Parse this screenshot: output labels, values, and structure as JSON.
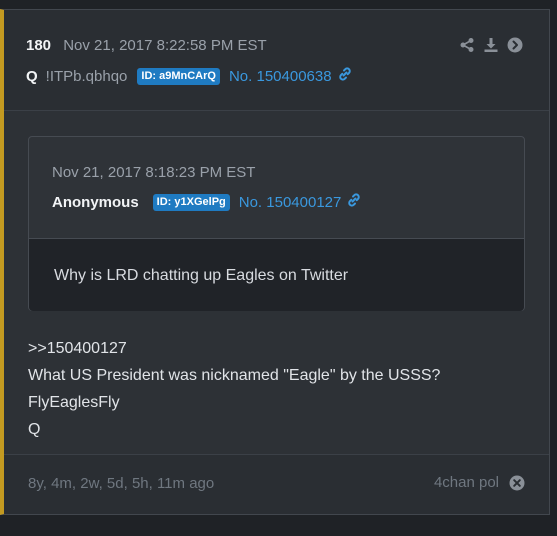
{
  "post": {
    "number": "180",
    "datetime": "Nov 21, 2017 8:22:58 PM EST",
    "author": "Q",
    "tripcode": "!ITPb.qbhqo",
    "id_badge": "ID: a9MnCArQ",
    "post_no": "No. 150400638",
    "body_lines": [
      ">>150400127",
      "What US President was nicknamed \"Eagle\" by the USSS?",
      "FlyEaglesFly",
      "Q"
    ]
  },
  "actions": {
    "icons": [
      "share-icon",
      "download-icon",
      "arrow-circle-right-icon"
    ]
  },
  "quoted": {
    "datetime": "Nov 21, 2017 8:18:23 PM EST",
    "author": "Anonymous",
    "id_badge": "ID: y1XGelPg",
    "post_no": "No. 150400127",
    "text": "Why is LRD chatting up Eagles on Twitter"
  },
  "footer": {
    "ago": "8y, 4m, 2w, 5d, 5h, 11m ago",
    "source": "4chan pol"
  },
  "colors": {
    "accent_border": "#c39a21",
    "id_badge_bg": "#1f7bc2",
    "link": "#3a98de"
  }
}
